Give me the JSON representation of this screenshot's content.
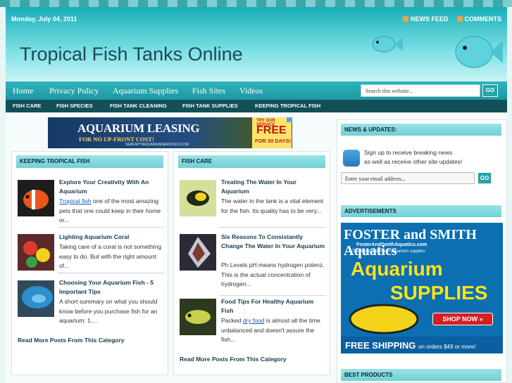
{
  "header": {
    "date": "Monday, July 04, 2011",
    "site_title": "Tropical Fish Tanks Online",
    "topnav": [
      "NEWS FEED",
      "COMMENTS"
    ]
  },
  "mainnav": {
    "items": [
      "Home",
      "Privacy Policy",
      "Aquarium Supplies",
      "Fish Sites",
      "Videos"
    ],
    "search_placeholder": "Search this website...",
    "go": "GO"
  },
  "catnav": [
    "FISH CARE",
    "FISH SPECIES",
    "FISH TANK CLEANING",
    "FISH TANK SUPPLIES",
    "KEEPING TROPICAL FISH"
  ],
  "banner": {
    "line1": "AQUARIUM LEASING",
    "line2": "FOR NO UP-FRONT COST!",
    "line3": "SERENITYAQUARIUMSERVICES.COM",
    "r1": "TRY OUR SERVICE",
    "r2": "FREE",
    "r3": "FOR 30 DAYS!"
  },
  "left_col": {
    "heading": "KEEPING TROPICAL FISH",
    "posts": [
      {
        "title": "Explore Your Creativity With An Aquarium",
        "link": "Tropical fish",
        "excerpt": " one of the most amazing pets that one could keep in their home or..."
      },
      {
        "title": "Lighting Aquarium Coral",
        "excerpt": "Taking care of a coral is not something easy to do. But with the right amount of..."
      },
      {
        "title": "Choosing Your Aquarium Fish - 5 Important Tips",
        "excerpt": "A short summary on what you should know before you purchase fish for an aquarium:   1...."
      }
    ],
    "more": "Read More Posts From This Category"
  },
  "mid_col": {
    "heading": "FISH CARE",
    "posts": [
      {
        "title": "Treating The Water In Your Aquarium",
        "excerpt": "The water in the tank is a vital element for the fish. Its quality has to be very..."
      },
      {
        "title": "Six Reasons To Consistantly Change The Water In Your Aquarium",
        "excerpt": "Ph Levels pH means hydrogen potenz. This is the actual concentration of hydrogen..."
      },
      {
        "title": "Food Tips For Healthy Aquarium Fish",
        "pre": "Packed ",
        "link": "dry food",
        "excerpt": " is almost all the time unbalanced and doesn't assure the fish..."
      }
    ],
    "more": "Read More Posts From This Category"
  },
  "sidebar": {
    "news_heading": "NEWS & UPDATES:",
    "news_text1": "Sign up to receive breaking news",
    "news_text2": "as well as receive other site updates!",
    "email_placeholder": "Enter your email address...",
    "go": "GO",
    "ads_heading": "ADVERTISEMENTS",
    "ad": {
      "brand": "FOSTER and SMITH Aquatics",
      "site": "FosterAndSmithAquatics.com",
      "tag": "The trusted name in aquarium supplies",
      "big1": "Aquarium",
      "big2": "SUPPLIES",
      "shop": "SHOP NOW »",
      "ship": "FREE SHIPPING",
      "ship_small": "on orders $49 or more!"
    },
    "best_heading": "BEST PRODUCTS"
  }
}
